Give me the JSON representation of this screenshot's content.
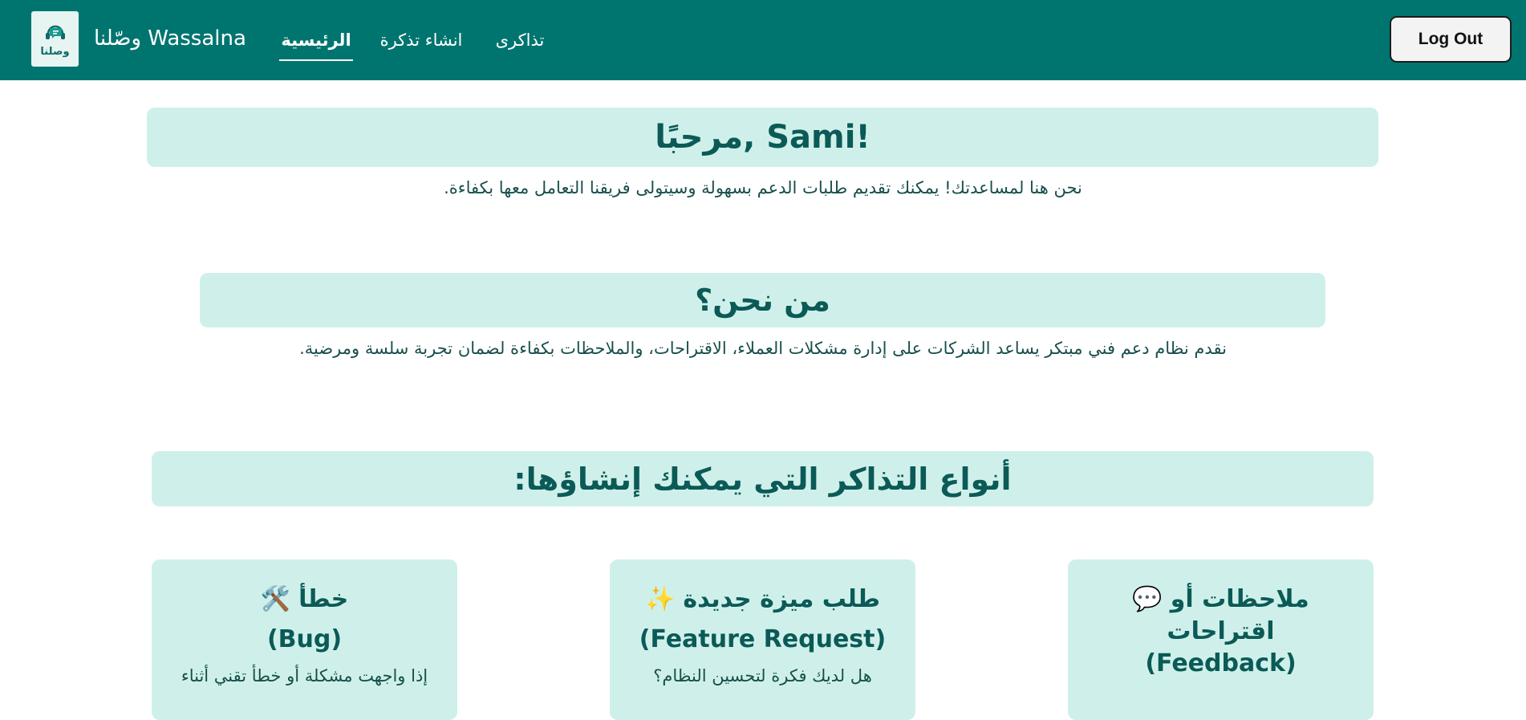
{
  "header": {
    "brand": "وصّلنا Wassalna",
    "logo_label": "وصلنا",
    "nav": {
      "home": "الرئيسية",
      "create_ticket": "انشاء تذكرة",
      "tickets": "تذاكرى"
    },
    "logout_label": "Log Out"
  },
  "welcome": {
    "title": "مرحبًا, Sami!",
    "text": "نحن هنا لمساعدتك! يمكنك تقديم طلبات الدعم بسهولة وسيتولى فريقنا التعامل معها بكفاءة."
  },
  "about": {
    "title": "من نحن؟",
    "text": "نقدم نظام دعم فني مبتكر يساعد الشركات على إدارة مشكلات العملاء، الاقتراحات، والملاحظات بكفاءة لضمان تجربة سلسة ومرضية."
  },
  "types": {
    "title": "أنواع التذاكر التي يمكنك إنشاؤها:",
    "cards": [
      {
        "title": "خطأ",
        "emoji": "🛠️",
        "subtitle": "(Bug)",
        "desc": "إذا واجهت مشكلة أو خطأ تقني أثناء"
      },
      {
        "title": "طلب ميزة جديدة",
        "emoji": "✨",
        "subtitle": "(Feature Request)",
        "desc": "هل لديك فكرة لتحسين النظام؟"
      },
      {
        "title": "ملاحظات أو",
        "title_line2": "اقتراحات",
        "emoji": "💬",
        "subtitle": "(Feedback)"
      }
    ]
  },
  "colors": {
    "navbar": "#007570",
    "box_background": "#cff0ea",
    "heading_text": "#0b5a57"
  }
}
